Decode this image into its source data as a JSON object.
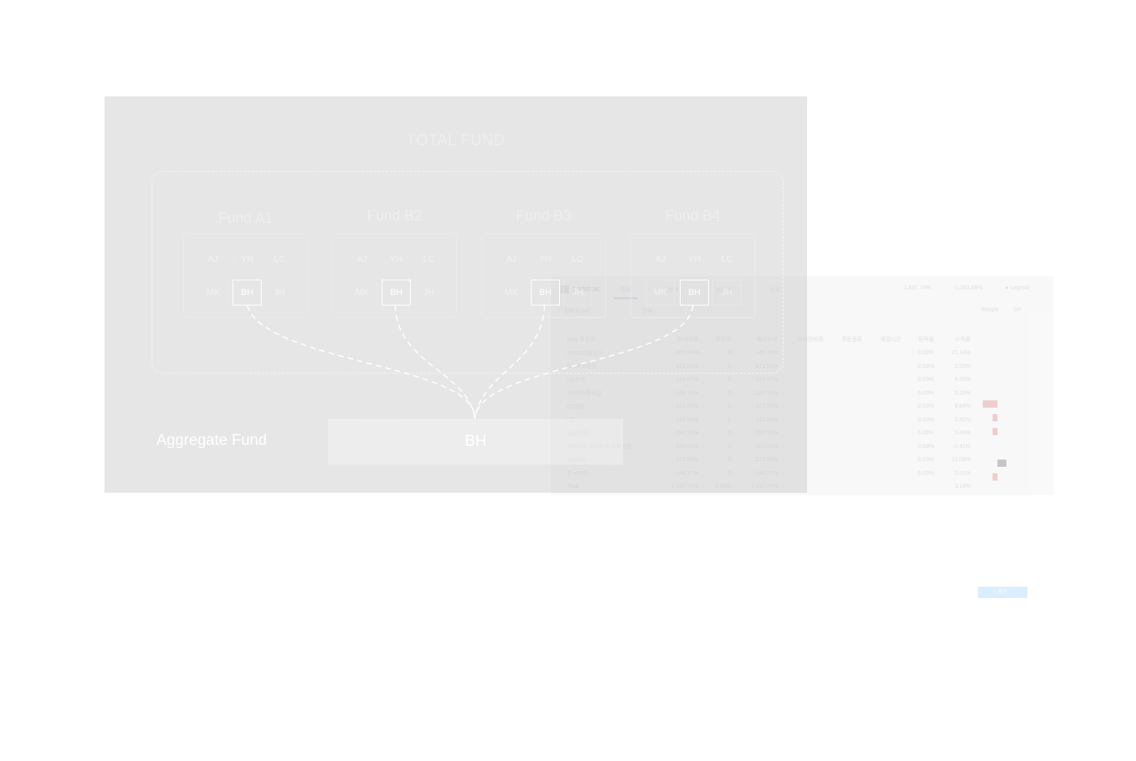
{
  "diagram": {
    "title": "TOTAL FUND",
    "funds": [
      {
        "name": "Fund A1",
        "members": [
          "AJ",
          "YH",
          "LC",
          "MK",
          "BH",
          "JH"
        ],
        "highlight": "BH"
      },
      {
        "name": "Fund B2",
        "members": [
          "AJ",
          "YH",
          "LC",
          "MK",
          "BH",
          "JH"
        ],
        "highlight": "BH"
      },
      {
        "name": "Fund B3",
        "members": [
          "AJ",
          "YH",
          "LC",
          "MK",
          "BH",
          "JH"
        ],
        "highlight": "BH"
      },
      {
        "name": "Fund B4",
        "members": [
          "AJ",
          "YH",
          "LC",
          "MK",
          "BH",
          "JH"
        ],
        "highlight": "BH"
      }
    ],
    "aggregate_label": "Aggregate Fund",
    "aggregate_member": "BH"
  },
  "dashboard": {
    "logo": "S BRIDGE",
    "tabs": [
      "투자",
      "분석",
      "리스크",
      "성과"
    ],
    "stats": [
      "1,437.74%",
      "-1,363.69%",
      "● Legend"
    ],
    "filter_label": "전체 Fund",
    "filter2_label": "전체",
    "controls": [
      "Weight",
      "1M"
    ],
    "columns": [
      "long 포지션",
      "현재비중",
      "주문량",
      "예상비중",
      "거래량비중",
      "주문종류",
      "체결시간",
      "등락률",
      "수익률"
    ],
    "rows": [
      [
        "POSCO홀딩스",
        "183.64%",
        "0",
        "-46.39%",
        "",
        "",
        "",
        "0.00%",
        "21.14%"
      ],
      [
        "NAVER홀딩",
        "171.56%",
        "0",
        "171.56%",
        "",
        "",
        "",
        "0.00%",
        "3.53%"
      ],
      [
        "LG전자",
        "124.37%",
        "0",
        "124.37%",
        "",
        "",
        "",
        "0.00%",
        "4.93%"
      ],
      [
        "HD현대중공업",
        "126.74%",
        "0",
        "126.74%",
        "",
        "",
        "",
        "0.00%",
        "5.18%"
      ],
      [
        "CJ대한",
        "115.56%",
        "0",
        "115.56%",
        "",
        "",
        "",
        "0.00%",
        "9.64%"
      ],
      [
        "LG",
        "141.90%",
        "0",
        "141.90%",
        "",
        "",
        "",
        "0.00%",
        "3.82%"
      ],
      [
        "삼성전자",
        "192.93%",
        "0",
        "192.93%",
        "",
        "",
        "",
        "0.00%",
        "3.46%"
      ],
      [
        "KOCKY GROUP 우호지분",
        "263.05%",
        "0",
        "263.05%",
        "",
        "",
        "",
        "0.00%",
        "-0.41%"
      ],
      [
        "SK하이",
        "271.99%",
        "0",
        "271.99%",
        "",
        "",
        "",
        "0.00%",
        "11.08%"
      ],
      [
        "한국타이",
        "244.77%",
        "0",
        "244.77%",
        "",
        "",
        "",
        "0.00%",
        "3.51%"
      ],
      [
        "Total",
        "1,437.74%",
        "0.00%",
        "1,437.74%",
        "",
        "",
        "",
        "",
        "3.14%"
      ]
    ],
    "apply_button": "확인"
  }
}
